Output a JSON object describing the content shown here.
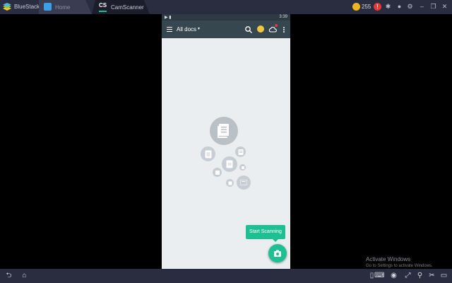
{
  "emulator": {
    "app_name": "BlueStacks",
    "tabs": [
      {
        "label": "Home"
      },
      {
        "label": "CamScanner",
        "icon_text": "CS"
      }
    ],
    "coins": "255",
    "alert_badge": "!",
    "icons": [
      "coin-icon",
      "alert-icon",
      "bug-icon",
      "user-icon",
      "gear-icon",
      "minimize-icon",
      "restore-icon",
      "close-icon"
    ],
    "bottom_icons": [
      "back-icon",
      "home-icon",
      "keyboard-icon",
      "eye-icon",
      "expand-icon",
      "location-icon",
      "scissors-icon",
      "phone-icon"
    ]
  },
  "android": {
    "status": {
      "icons": "▶ ▮",
      "time": "3:39"
    },
    "appbar": {
      "title": "All docs",
      "caret": "▾"
    },
    "empty_state": {
      "illustration": "documents-icon"
    },
    "fab": {
      "tooltip": "Start Scanning",
      "icon": "camera-icon"
    }
  },
  "watermark": {
    "line1": "Activate Windows",
    "line2": "Go to Settings to activate Windows."
  },
  "colors": {
    "accent": "#1fbf94",
    "appbar": "#37474f",
    "emulator_bar": "#2a2d3f",
    "screen_bg": "#ebeef0"
  }
}
